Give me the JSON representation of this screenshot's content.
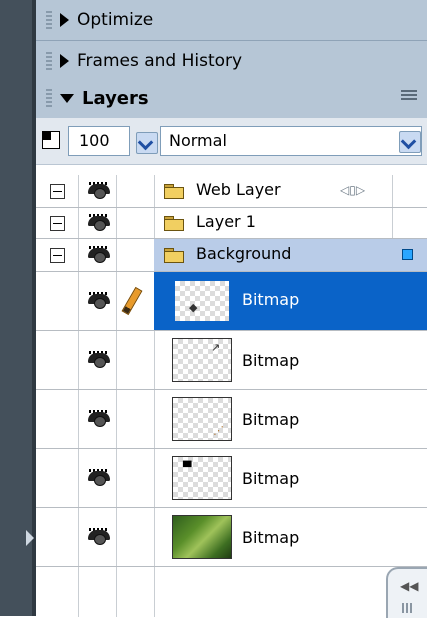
{
  "panels": {
    "optimize": {
      "title": "Optimize"
    },
    "frames": {
      "title": "Frames and History"
    },
    "layers": {
      "title": "Layers"
    }
  },
  "options": {
    "opacity": "100",
    "blend_mode": "Normal"
  },
  "layers": {
    "groups": [
      {
        "name": "Web Layer"
      },
      {
        "name": "Layer 1"
      },
      {
        "name": "Background"
      }
    ],
    "objects": [
      {
        "name": "Bitmap"
      },
      {
        "name": "Bitmap"
      },
      {
        "name": "Bitmap"
      },
      {
        "name": "Bitmap"
      },
      {
        "name": "Bitmap"
      }
    ]
  },
  "colors": {
    "panel_header": "#b6c6d6",
    "selection": "#0a63c8",
    "selection_light": "#b9cce8",
    "left_strip": "#44505b"
  },
  "icons": {
    "visibility": "eye-icon",
    "edit": "pencil-icon",
    "folder": "folder-icon",
    "collapse": "collapse-arrows-icon"
  }
}
